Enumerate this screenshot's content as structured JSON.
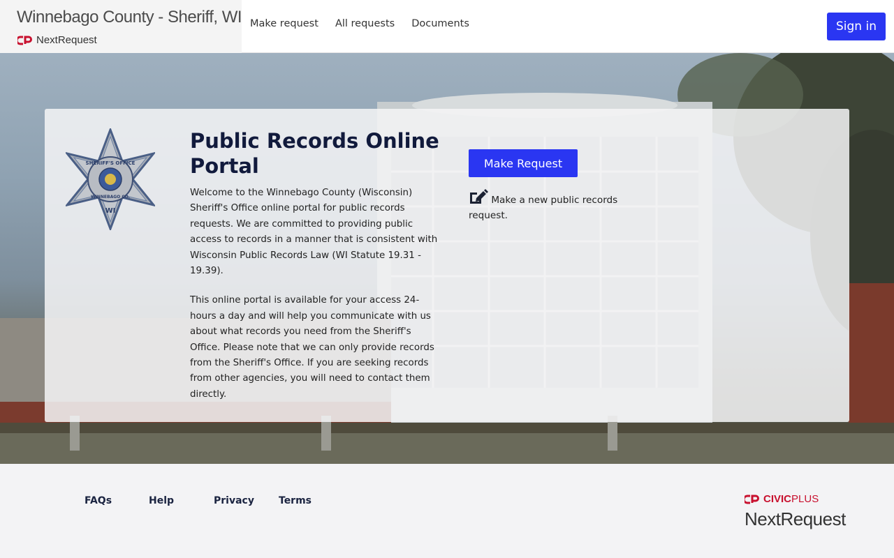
{
  "header": {
    "agency_title": "Winnebago County - Sheriff, WI",
    "brand_sub": "NextRequest",
    "nav": [
      {
        "label": "Make request"
      },
      {
        "label": "All requests"
      },
      {
        "label": "Documents"
      }
    ],
    "signin_label": "Sign in"
  },
  "hero": {
    "title": "Public Records Online Portal",
    "paragraphs": [
      "Welcome to the Winnebago County (Wisconsin) Sheriff's Office online portal for public records requests. We are committed to providing public access to records in a manner that is consistent with Wisconsin Public Records Law (WI Statute 19.31 - 19.39).",
      "This online portal is available for your access 24-hours a day and will help you communicate with us about what records you need from the Sheriff's Office. Please note that we can only provide records from the Sheriff's Office. If you are seeking records from other agencies, you will need to contact them directly."
    ],
    "make_request_label": "Make Request",
    "make_request_desc": "Make a new public records request.",
    "badge": {
      "top_text": "SHERIFF'S OFFICE",
      "bottom_text": "WINNEBAGO CO.",
      "state": "WI"
    }
  },
  "footer": {
    "links": [
      {
        "label": "FAQs"
      },
      {
        "label": "Help"
      },
      {
        "label": "Privacy"
      },
      {
        "label": "Terms"
      }
    ],
    "civic_part1": "CIVIC",
    "civic_part2": "PLUS",
    "product": "NextRequest"
  },
  "colors": {
    "accent": "#2a36f2",
    "civicplus_red": "#c8102e",
    "title_navy": "#111a3c"
  },
  "icons": [
    "civicplus-logo-icon",
    "edit-icon",
    "sheriff-star-badge"
  ]
}
